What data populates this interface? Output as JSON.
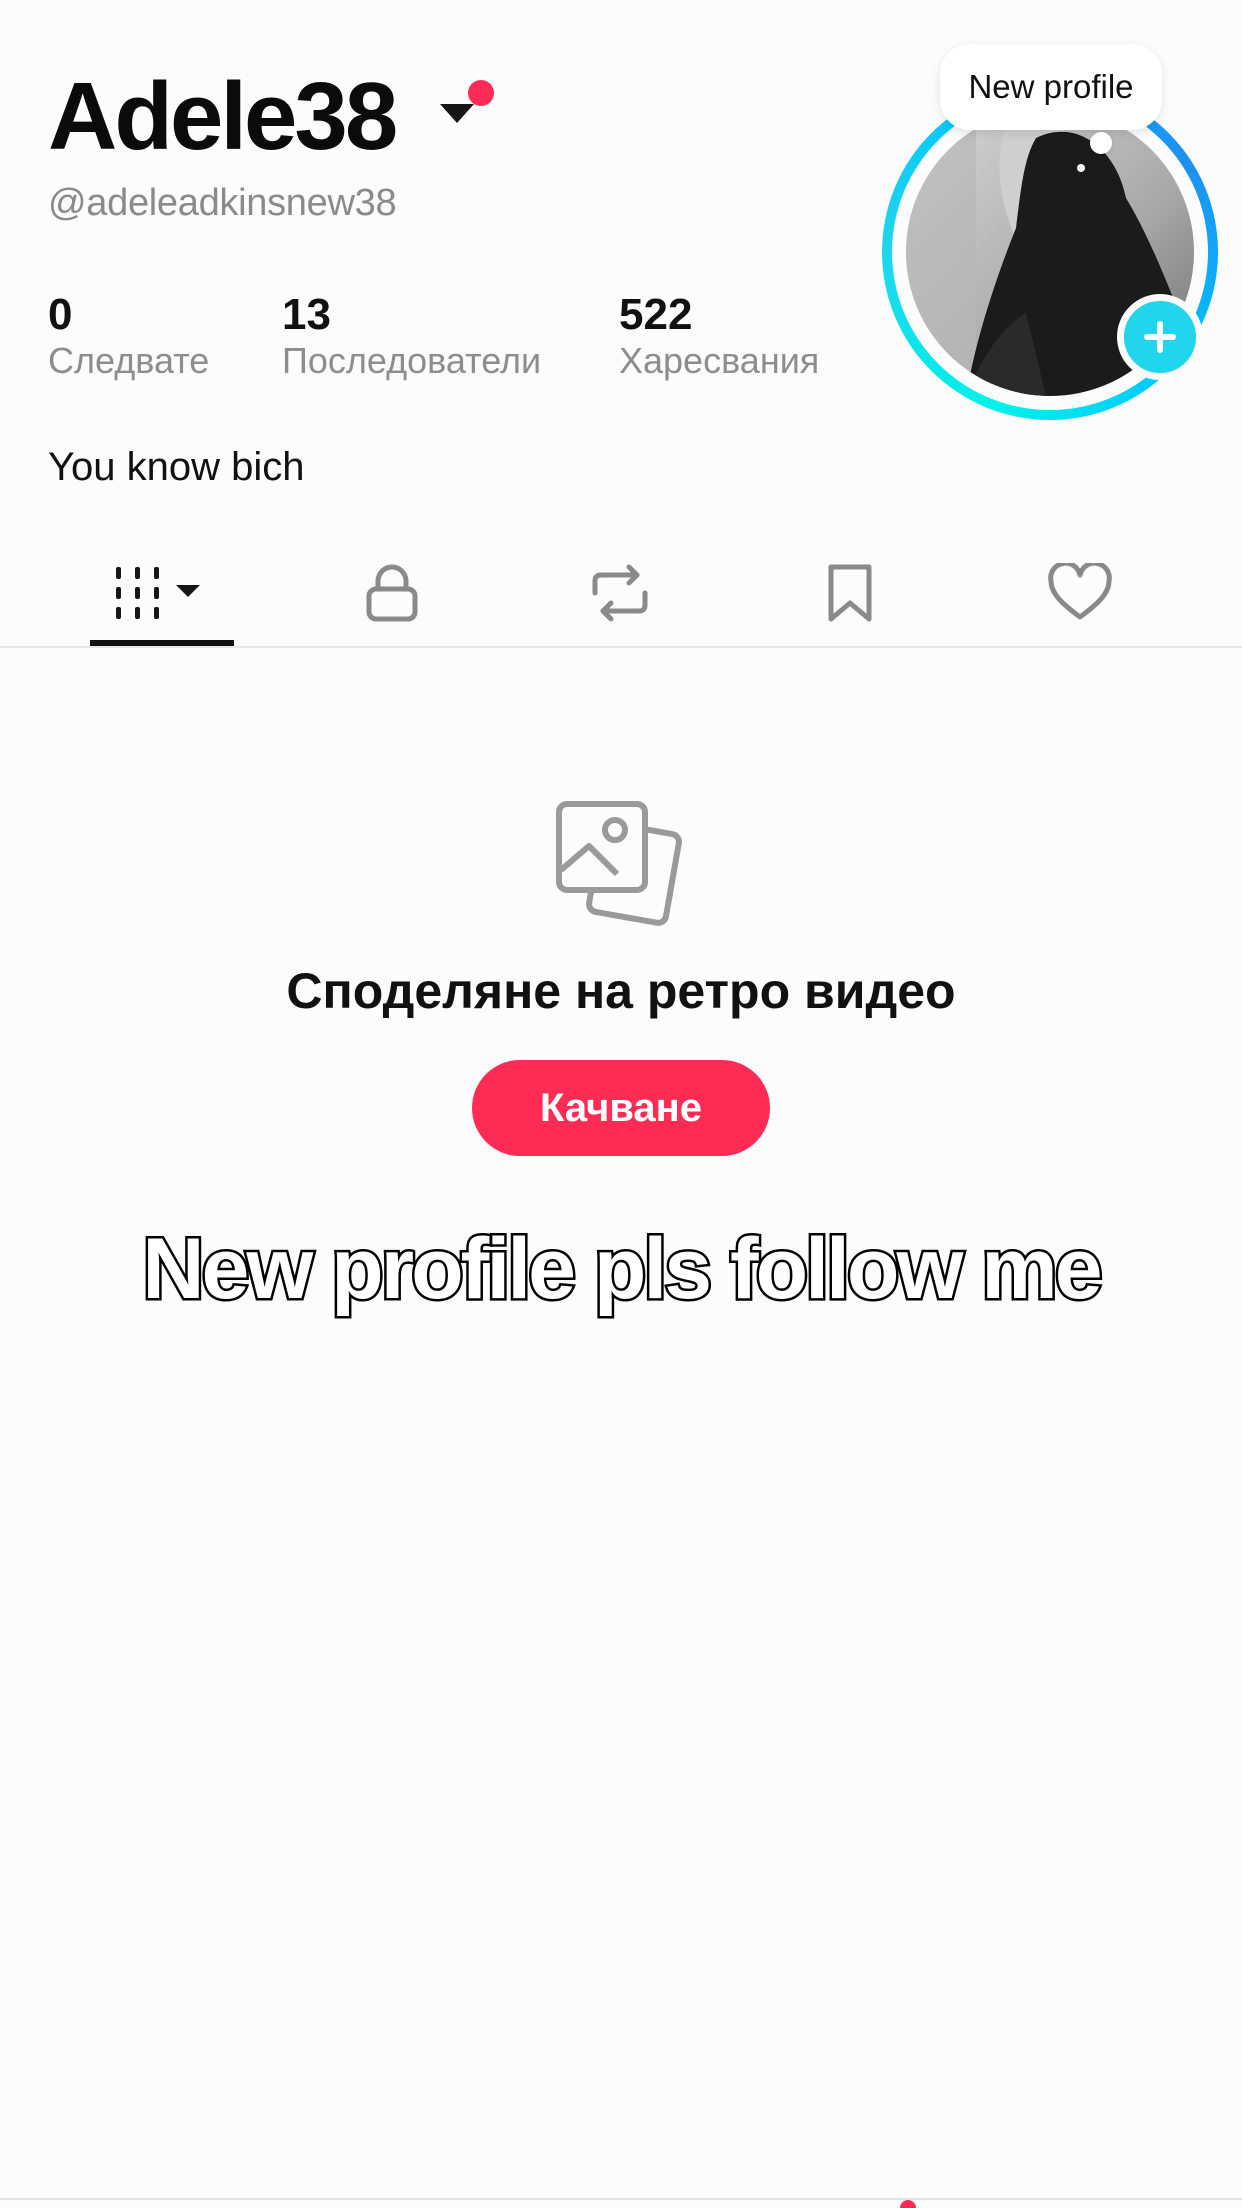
{
  "profile": {
    "display_name": "Adele38",
    "username": "@adeleadkinsnew38",
    "bio": "You know bich",
    "new_profile_bubble": "New profile"
  },
  "stats": [
    {
      "value": "0",
      "label": "Следвате"
    },
    {
      "value": "13",
      "label": "Последователи"
    },
    {
      "value": "522",
      "label": "Харесвания"
    }
  ],
  "tabs": [
    {
      "name": "videos",
      "icon": "grid-icon",
      "active": true
    },
    {
      "name": "private",
      "icon": "lock-icon",
      "active": false
    },
    {
      "name": "reposts",
      "icon": "repost-icon",
      "active": false
    },
    {
      "name": "favorites",
      "icon": "bookmark-icon",
      "active": false
    },
    {
      "name": "liked",
      "icon": "heart-icon",
      "active": false
    }
  ],
  "empty_state": {
    "icon": "photos-icon",
    "title": "Споделяне на ретро видео",
    "button_label": "Качване"
  },
  "overlay_caption": "New profile pls follow me",
  "colors": {
    "accent": "#fe2c55",
    "ring": "#20d5ec",
    "background": "#fcfcfc"
  }
}
